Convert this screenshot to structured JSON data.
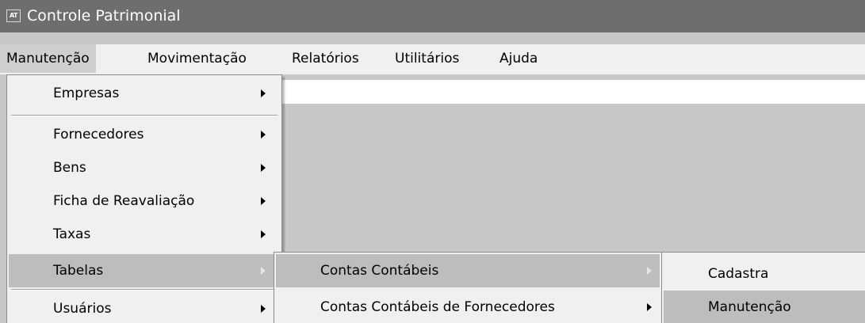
{
  "window": {
    "title": "Controle Patrimonial",
    "icon_text": "AT",
    "icon": "app-icon"
  },
  "menubar": {
    "items": [
      "Manutenção",
      "Movimentação",
      "Relatórios",
      "Utilitários",
      "Ajuda"
    ],
    "active": "Manutenção"
  },
  "menu_manutencao": {
    "items": [
      {
        "label": "Empresas",
        "has_submenu": true
      },
      {
        "label": "Fornecedores",
        "has_submenu": true
      },
      {
        "label": "Bens",
        "has_submenu": true
      },
      {
        "label": "Ficha de Reavaliação",
        "has_submenu": true
      },
      {
        "label": "Taxas",
        "has_submenu": true
      },
      {
        "label": "Tabelas",
        "has_submenu": true,
        "highlighted": true
      },
      {
        "label": "Usuários",
        "has_submenu": true
      }
    ]
  },
  "menu_tabelas": {
    "items": [
      {
        "label": "Contas Contábeis",
        "has_submenu": true,
        "highlighted": true
      },
      {
        "label": "Contas Contábeis de Fornecedores",
        "has_submenu": true
      }
    ]
  },
  "menu_contas_contabeis": {
    "items": [
      {
        "label": "Cadastra"
      },
      {
        "label": "Manutenção",
        "highlighted": true
      }
    ]
  },
  "colors": {
    "titlebar": "#6e6e6e",
    "menu_bg": "#f0f0f0",
    "highlight": "#bdbdbd",
    "background": "#c8c8c8"
  }
}
